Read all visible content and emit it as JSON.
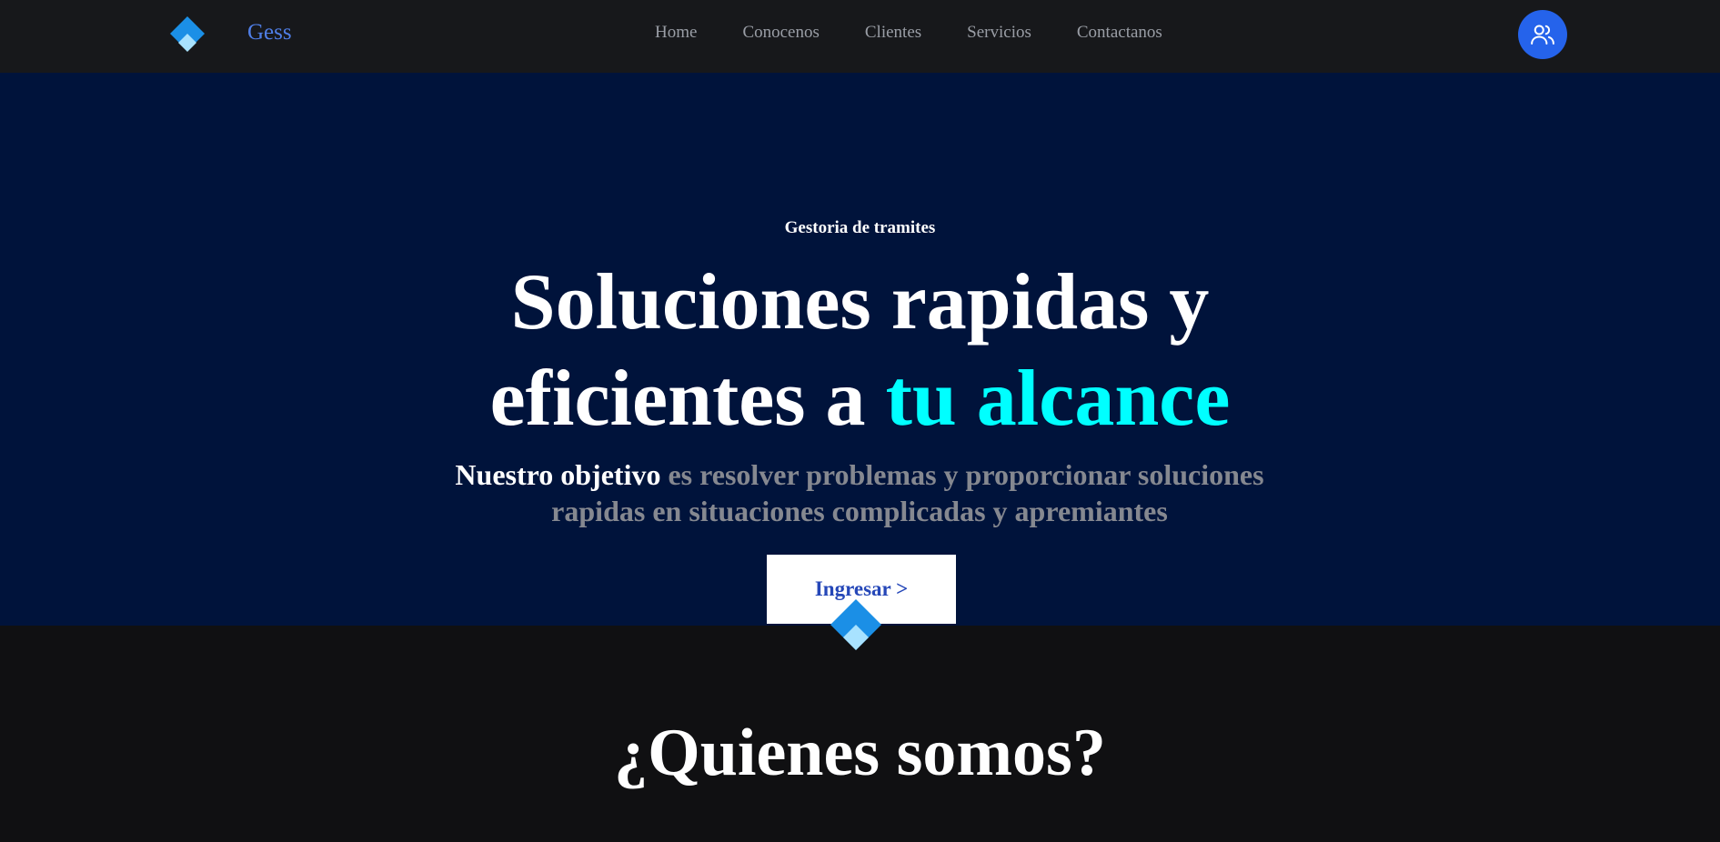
{
  "brand": {
    "name": "Gess",
    "logo_icon": "blue-diamond-icon",
    "colors": {
      "primary": "#1b8fe6",
      "light": "#a8e2ff",
      "name_text": "#4f7ee6"
    }
  },
  "nav": {
    "links": [
      {
        "label": "Home"
      },
      {
        "label": "Conocenos"
      },
      {
        "label": "Clientes"
      },
      {
        "label": "Servicios"
      },
      {
        "label": "Contactanos"
      }
    ],
    "user_button": {
      "icon": "users-icon",
      "color": "#2563eb"
    }
  },
  "hero": {
    "eyebrow": "Gestoria de tramites",
    "headline_line1": "Soluciones rapidas y",
    "headline_line2_prefix": "eficientes a ",
    "headline_accent": "tu alcance",
    "accent_color": "#00ffff",
    "subtitle_strong": "Nuestro objetivo",
    "subtitle_rest": " es resolver problemas y proporcionar soluciones rapidas en situaciones complicadas y apremiantes",
    "cta_label": "Ingresar >",
    "background": "#00133b"
  },
  "about": {
    "title": "¿Quienes somos?",
    "divider_icon": "blue-diamond-icon"
  }
}
